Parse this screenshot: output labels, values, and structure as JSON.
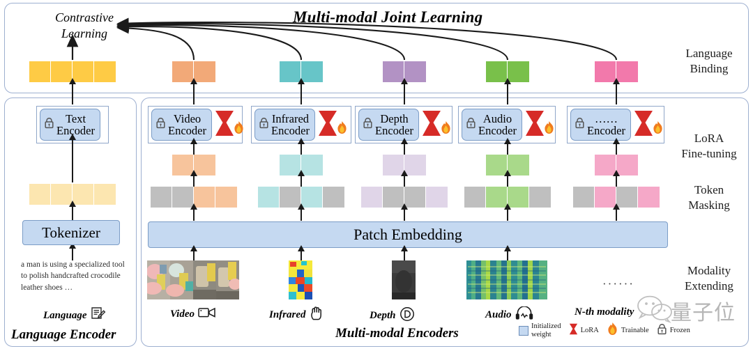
{
  "figure": {
    "title": "Multi-modal Joint Learning",
    "contrastive_label": "Contrastive Learning",
    "contrastive_line1": "Contrastive",
    "contrastive_line2": "Learning"
  },
  "stage_labels": {
    "language_binding_l1": "Language",
    "language_binding_l2": "Binding",
    "lora_l1": "LoRA",
    "lora_l2": "Fine-tuning",
    "token_l1": "Token",
    "token_l2": "Masking",
    "modality_l1": "Modality",
    "modality_l2": "Extending"
  },
  "sections": {
    "language_encoder": "Language Encoder",
    "multimodal_encoders": "Multi-modal Encoders"
  },
  "language_branch": {
    "caption_text": "a man is using a specialized tool to polish handcrafted crocodile leather shoes …",
    "modality_label": "Language",
    "modality_icon": "note-pencil-icon",
    "tokenizer_label": "Tokenizer",
    "encoder_label_l1": "Text",
    "encoder_label_l2": "Encoder",
    "encoder_lock_icon": "lock-icon",
    "token_blocks": 4,
    "token_block_color": "#fce6b0",
    "output_blocks": 4,
    "output_block_color": "#fecb45"
  },
  "patch_embedding": {
    "label": "Patch Embedding"
  },
  "branches": [
    {
      "name": "video",
      "modality_label": "Video",
      "modality_icon": "video-camera-icon",
      "encoder_l1": "Video",
      "encoder_l2": "Encoder",
      "lock_icon": "lock-icon",
      "lora_icon": "lora-hourglass-icon",
      "flame_icon": "flame-icon",
      "color": "#f7c49c",
      "masked_color": "#bfbfbf",
      "mask_pattern": [
        "masked",
        "masked",
        "color",
        "color"
      ],
      "embed_blocks": 2,
      "output_blocks": 2,
      "output_color": "#f2a978",
      "thumbnail": "video-frames-thumbnail"
    },
    {
      "name": "infrared",
      "modality_label": "Infrared",
      "modality_icon": "hand-heat-icon",
      "encoder_l1": "Infrared",
      "encoder_l2": "Encoder",
      "lock_icon": "lock-icon",
      "lora_icon": "lora-hourglass-icon",
      "flame_icon": "flame-icon",
      "color": "#b6e3e3",
      "masked_color": "#bfbfbf",
      "mask_pattern": [
        "color",
        "masked",
        "color",
        "masked"
      ],
      "embed_blocks": 2,
      "output_blocks": 2,
      "output_color": "#67c5c8",
      "thumbnail": "infrared-heatmap-thumbnail"
    },
    {
      "name": "depth",
      "modality_label": "Depth",
      "modality_icon": "depth-d-circle-icon",
      "encoder_l1": "Depth",
      "encoder_l2": "Encoder",
      "lock_icon": "lock-icon",
      "lora_icon": "lora-hourglass-icon",
      "flame_icon": "flame-icon",
      "color": "#e0d5e8",
      "masked_color": "#bfbfbf",
      "mask_pattern": [
        "color",
        "masked",
        "masked",
        "color"
      ],
      "embed_blocks": 2,
      "output_blocks": 2,
      "output_color": "#b292c4",
      "thumbnail": "depth-map-thumbnail"
    },
    {
      "name": "audio",
      "modality_label": "Audio",
      "modality_icon": "headphones-icon",
      "encoder_l1": "Audio",
      "encoder_l2": "Encoder",
      "lock_icon": "lock-icon",
      "lora_icon": "lora-hourglass-icon",
      "flame_icon": "flame-icon",
      "color": "#a9d98a",
      "masked_color": "#bfbfbf",
      "mask_pattern": [
        "masked",
        "color",
        "color",
        "masked"
      ],
      "embed_blocks": 2,
      "output_blocks": 2,
      "output_color": "#79c04a",
      "thumbnail": "audio-spectrogram-thumbnail"
    },
    {
      "name": "nth",
      "modality_label": "N-th modality",
      "modality_icon": "ellipsis-icon",
      "encoder_l1": "……",
      "encoder_l2": "Encoder",
      "lock_icon": "lock-icon",
      "lora_icon": "lora-hourglass-icon",
      "flame_icon": "flame-icon",
      "color": "#f5a8c8",
      "masked_color": "#bfbfbf",
      "mask_pattern": [
        "masked",
        "color",
        "masked",
        "color"
      ],
      "embed_blocks": 2,
      "output_blocks": 2,
      "output_color": "#f279ab",
      "thumbnail": "ellipsis-placeholder",
      "ellipsis": "······"
    }
  ],
  "legend": [
    {
      "label_l1": "Initialized",
      "label_l2": "weight",
      "icon": "blue-square-icon"
    },
    {
      "label_l1": "LoRA",
      "label_l2": "",
      "icon": "lora-hourglass-icon"
    },
    {
      "label_l1": "Trainable",
      "label_l2": "",
      "icon": "flame-icon"
    },
    {
      "label_l1": "Frozen",
      "label_l2": "",
      "icon": "lock-icon"
    }
  ],
  "watermark": {
    "text": "量子位",
    "icon": "wechat-logo-icon"
  },
  "colors": {
    "panel_border": "#9dafd0",
    "box_fill": "#c5d9f1",
    "box_border": "#7b9cc6",
    "lora_red": "#d62b27",
    "masked_gray": "#bfbfbf"
  }
}
